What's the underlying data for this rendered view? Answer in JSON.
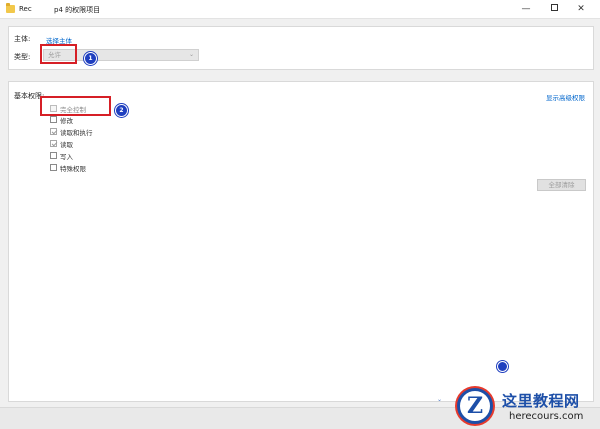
{
  "window": {
    "title_left": "Rec",
    "title_main": "p4 的权限项目",
    "minimize_glyph": "—",
    "close_glyph": "✕",
    "icon": "folder-icon"
  },
  "principal": {
    "label": "主体:",
    "link": "选择主体"
  },
  "type": {
    "label": "类型:",
    "value": "允许",
    "arrow": "⌄"
  },
  "annotations": {
    "badge_1": "1",
    "badge_2": "2"
  },
  "basic_permissions": {
    "title": "基本权限:",
    "show_advanced": "显示高级权限",
    "items": [
      {
        "label": "完全控制",
        "checked": false
      },
      {
        "label": "修改",
        "checked": false
      },
      {
        "label": "读取和执行",
        "checked": true
      },
      {
        "label": "读取",
        "checked": true
      },
      {
        "label": "写入",
        "checked": false
      },
      {
        "label": "特殊权限",
        "checked": false
      }
    ],
    "clear_all": "全部清除"
  },
  "watermark": {
    "logo_letter": "Z",
    "name": "这里教程网",
    "domain": "herecours.com"
  },
  "colors": {
    "link": "#0066cc",
    "annotation_red": "#d61f26",
    "badge_blue": "#1f3fbf"
  }
}
